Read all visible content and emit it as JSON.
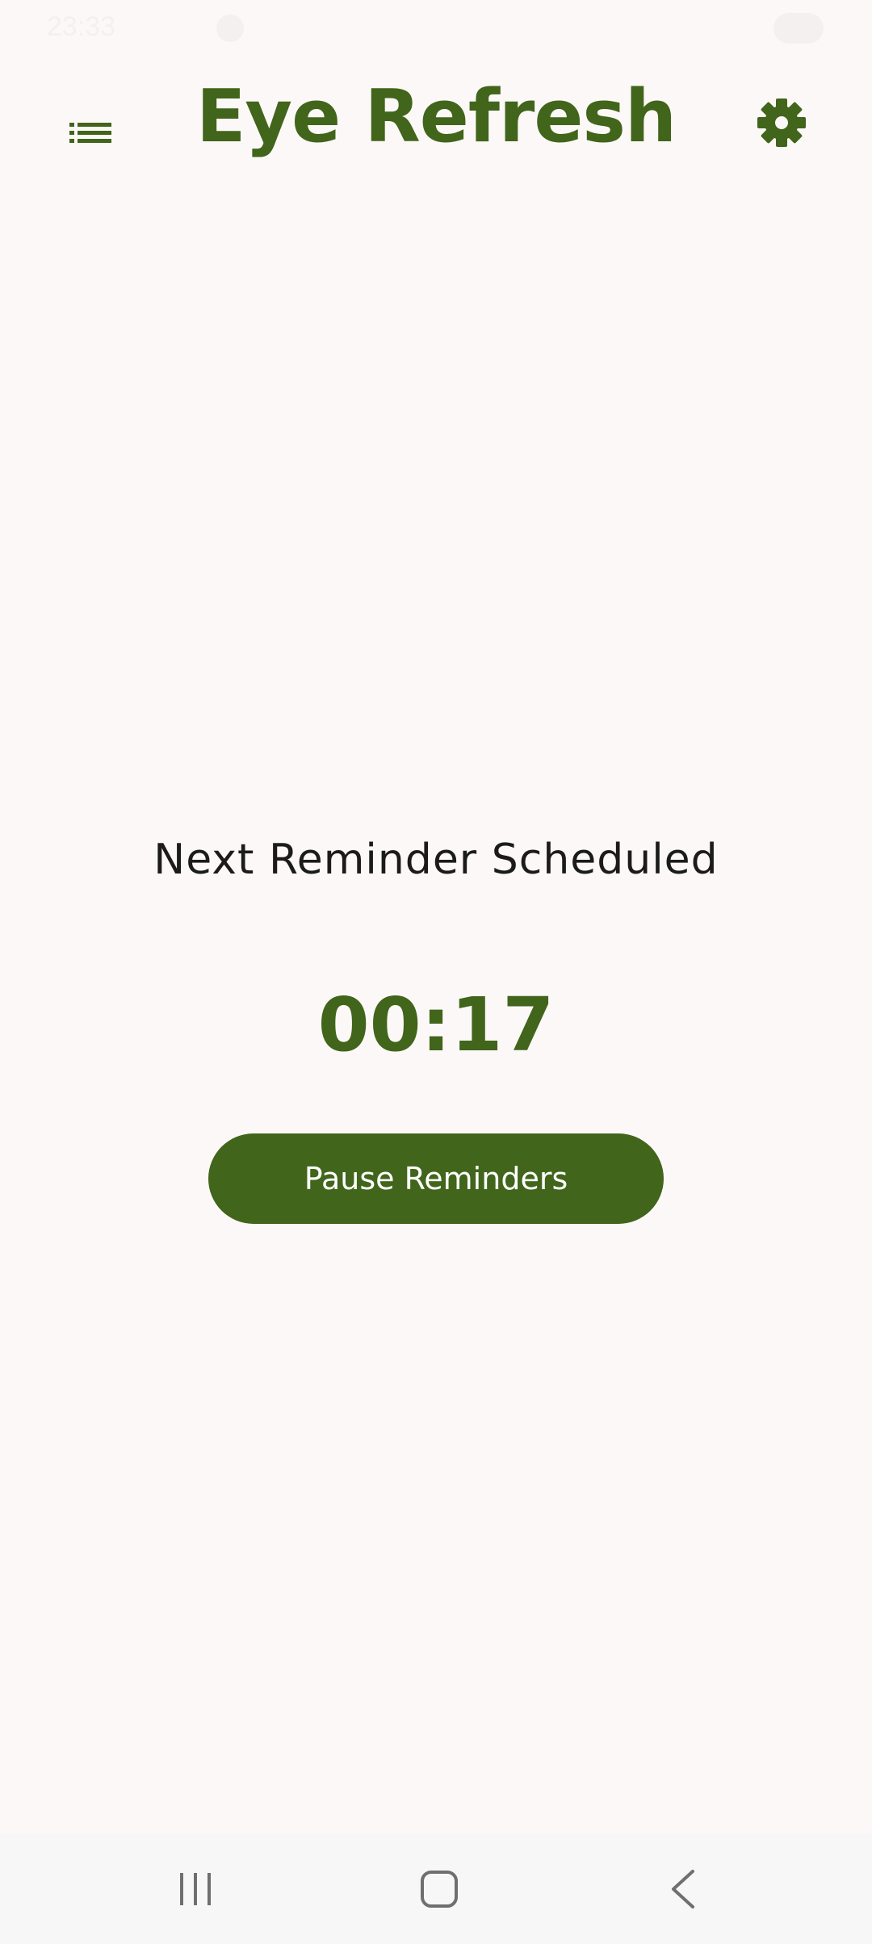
{
  "status_bar": {
    "time": "23:33"
  },
  "app_bar": {
    "title": "Eye Refresh",
    "menu_icon": "list-icon",
    "settings_icon": "gear-icon"
  },
  "main": {
    "next_label": "Next Reminder Scheduled",
    "countdown": "00:17",
    "pause_label": "Pause Reminders"
  },
  "nav_bar": {
    "recents_icon": "recents-icon",
    "home_icon": "home-icon",
    "back_icon": "back-icon"
  },
  "colors": {
    "primary": "#41651a",
    "background": "#fdf8f8",
    "text": "#1c1b1c"
  }
}
